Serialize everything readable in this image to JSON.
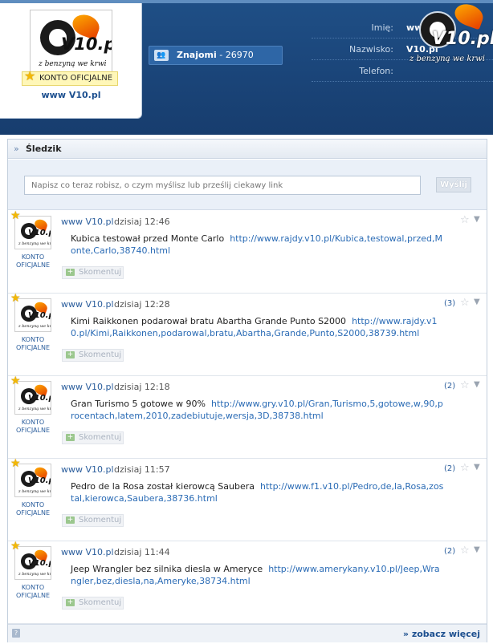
{
  "profile": {
    "logo_text": "V10.pl",
    "logo_slogan": "z benzyną we krwi",
    "badge": "KONTO OFICJALNE",
    "name": "www V10.pl"
  },
  "friends": {
    "label": "Znajomi",
    "separator": " - ",
    "count": "26970"
  },
  "info": {
    "rows": [
      {
        "label": "Imię:",
        "value": "ww"
      },
      {
        "label": "Nazwisko:",
        "value": "V10.pl"
      },
      {
        "label": "Telefon:",
        "value": ""
      }
    ]
  },
  "feed": {
    "title": "Śledzik",
    "title_arrow": "»",
    "input_placeholder": "Napisz co teraz robisz, o czym myślisz lub prześlij ciekawy link",
    "send_label": "Wyślij",
    "comment_label": "Skomentuj",
    "official_label": "KONTO OFICJALNE",
    "see_more": "» zobacz więcej",
    "help": "?",
    "posts": [
      {
        "author": "www V10.pl",
        "time": "dzisiaj 12:46",
        "text": "Kubica testował przed Monte Carlo",
        "link": "http://www.rajdy.v10.pl/Kubica,testowal,przed,Monte,Carlo,38740.html",
        "comments": ""
      },
      {
        "author": "www V10.pl",
        "time": "dzisiaj 12:28",
        "text": "Kimi Raikkonen podarował bratu Abartha Grande Punto S2000",
        "link": "http://www.rajdy.v10.pl/Kimi,Raikkonen,podarowal,bratu,Abartha,Grande,Punto,S2000,38739.html",
        "comments": "(3)"
      },
      {
        "author": "www V10.pl",
        "time": "dzisiaj 12:18",
        "text": "Gran Turismo 5 gotowe w 90%",
        "link": "http://www.gry.v10.pl/Gran,Turismo,5,gotowe,w,90,procentach,latem,2010,zadebiutuje,wersja,3D,38738.html",
        "comments": "(2)"
      },
      {
        "author": "www V10.pl",
        "time": "dzisiaj 11:57",
        "text": "Pedro de la Rosa został kierowcą Saubera",
        "link": "http://www.f1.v10.pl/Pedro,de,la,Rosa,zostal,kierowca,Saubera,38736.html",
        "comments": "(2)"
      },
      {
        "author": "www V10.pl",
        "time": "dzisiaj 11:44",
        "text": "Jeep Wrangler bez silnika diesla w Ameryce",
        "link": "http://www.amerykany.v10.pl/Jeep,Wrangler,bez,diesla,na,Ameryke,38734.html",
        "comments": "(2)"
      }
    ]
  },
  "colors": {
    "header_bg": "#1a4478",
    "link": "#2a6bb5",
    "accent": "#1c4f8f",
    "star": "#f2b807"
  }
}
